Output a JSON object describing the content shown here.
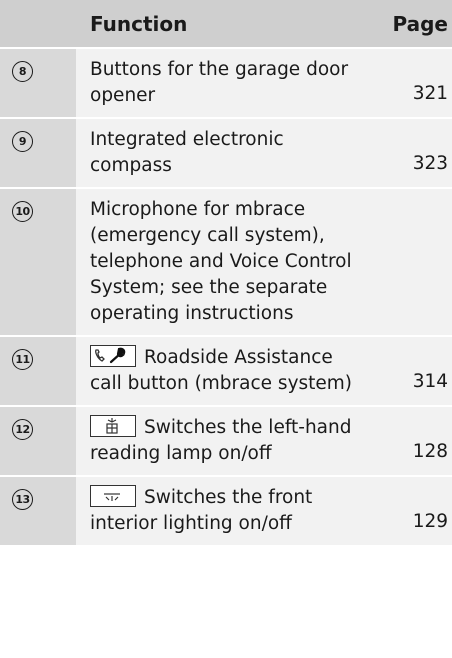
{
  "header": {
    "function_label": "Function",
    "page_label": "Page"
  },
  "rows": [
    {
      "number": "8",
      "text": "Buttons for the garage door opener",
      "page": "321"
    },
    {
      "number": "9",
      "text": "Integrated electronic compass",
      "page": "323"
    },
    {
      "number": "10",
      "text": "Microphone for mbrace (emergency call system), telephone and Voice Control System; see the separate operating instructions",
      "page": ""
    },
    {
      "number": "11",
      "icon": "phone-wrench-icon",
      "text": "Roadside Assistance call button (mbrace system)",
      "page": "314"
    },
    {
      "number": "12",
      "icon": "reading-lamp-icon",
      "text": "Switches the left-hand reading lamp on/off",
      "page": "128"
    },
    {
      "number": "13",
      "icon": "interior-light-icon",
      "text": "Switches the front interior lighting on/off",
      "page": "129"
    }
  ]
}
